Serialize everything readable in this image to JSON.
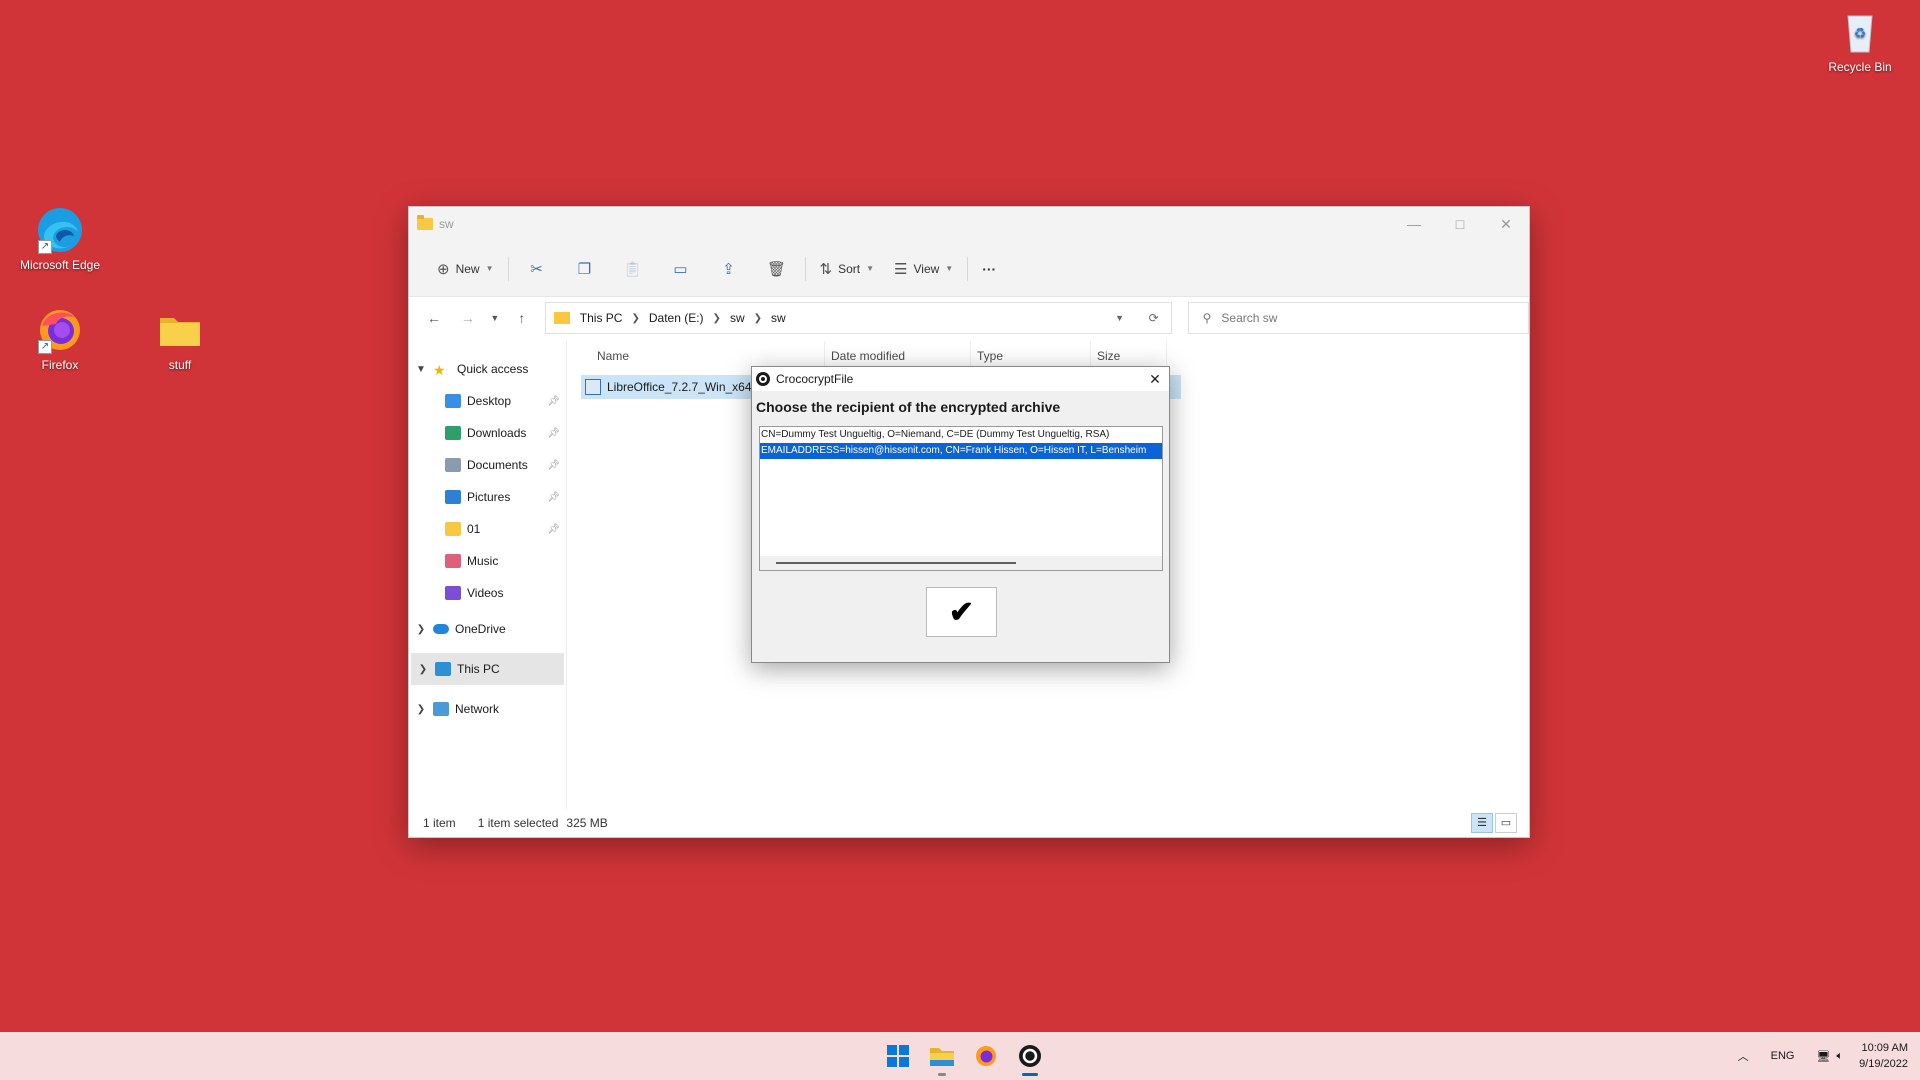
{
  "desktop": {
    "icons": {
      "edge": "Microsoft Edge",
      "firefox": "Firefox",
      "stuff": "stuff",
      "recycle": "Recycle Bin"
    }
  },
  "explorer": {
    "title": "sw",
    "toolbar": {
      "new_label": "New",
      "sort_label": "Sort",
      "view_label": "View",
      "more_label": "···"
    },
    "breadcrumb": [
      "This PC",
      "Daten (E:)",
      "sw",
      "sw"
    ],
    "search_placeholder": "Search sw",
    "sidebar": {
      "quick_access": "Quick access",
      "items": [
        {
          "label": "Desktop",
          "icon": "desktop-icon",
          "color": "#3a8ee6",
          "pinned": true
        },
        {
          "label": "Downloads",
          "icon": "download-icon",
          "color": "#2e9e6a",
          "pinned": true
        },
        {
          "label": "Documents",
          "icon": "document-icon",
          "color": "#8a9bb0",
          "pinned": true
        },
        {
          "label": "Pictures",
          "icon": "picture-icon",
          "color": "#2f7fd6",
          "pinned": true
        },
        {
          "label": "01",
          "icon": "folder-icon",
          "color": "#f8c940",
          "pinned": true
        },
        {
          "label": "Music",
          "icon": "music-icon",
          "color": "#e0607a",
          "pinned": false
        },
        {
          "label": "Videos",
          "icon": "video-icon",
          "color": "#7a4fd6",
          "pinned": false
        }
      ],
      "onedrive": "OneDrive",
      "this_pc": "This PC",
      "network": "Network"
    },
    "columns": {
      "name": "Name",
      "date_modified": "Date modified",
      "type": "Type",
      "size": "Size"
    },
    "files": [
      {
        "name": "LibreOffice_7.2.7_Win_x64"
      }
    ],
    "status": {
      "count": "1 item",
      "selected": "1 item selected",
      "size": "325 MB"
    }
  },
  "dialog": {
    "title": "CrococryptFile",
    "heading": "Choose the recipient of the encrypted archive",
    "recipients": [
      "CN=Dummy Test Ungueltig, O=Niemand, C=DE (Dummy Test Ungueltig, RSA)",
      "EMAILADDRESS=hissen@hissenit.com, CN=Frank Hissen, O=Hissen IT, L=Bensheim"
    ],
    "selected_index": 1,
    "confirm_label": "✔"
  },
  "taskbar": {
    "language": "ENG",
    "time": "10:09 AM",
    "date": "9/19/2022"
  },
  "colors": {
    "desktop_bg": "#d13438",
    "selection": "#0a64d8",
    "accent": "#0067c0"
  }
}
